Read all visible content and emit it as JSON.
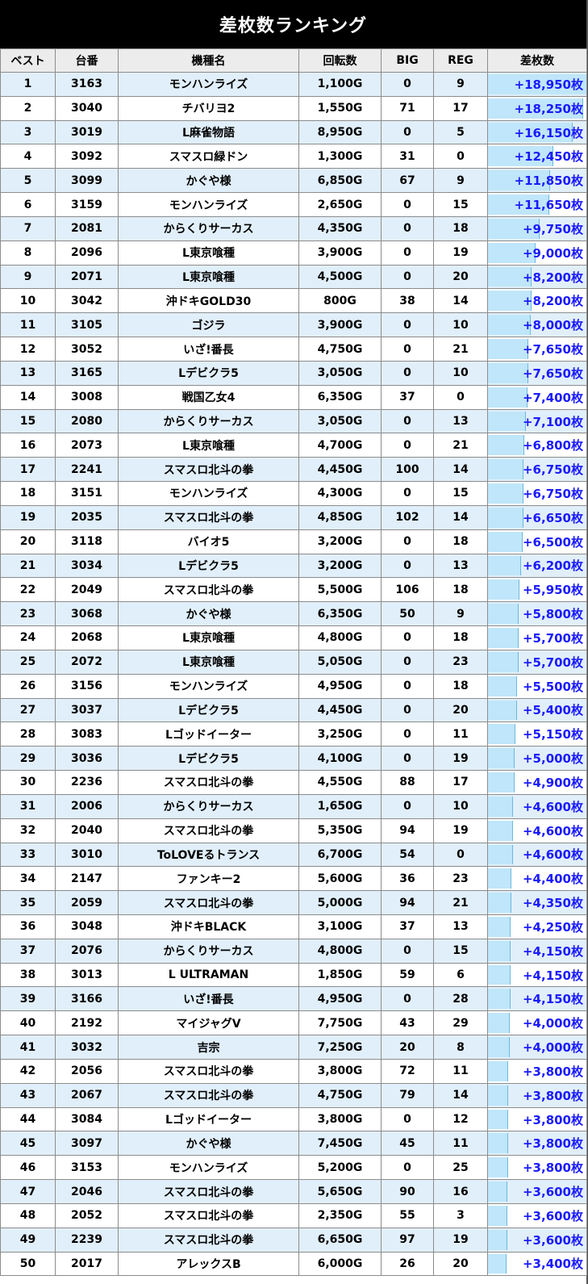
{
  "title": "差枚数ランキング",
  "headers": [
    "ベスト",
    "台番",
    "機種名",
    "回転数",
    "BIG",
    "REG",
    "差枚数"
  ],
  "colors": {
    "header_bg": "#000000",
    "odd_row": "#e1effa",
    "bar": "#bfe6fa",
    "diff_text": "#1a1aff"
  },
  "bar_max": 18950,
  "rows": [
    {
      "rank": "1",
      "machine_no": "3163",
      "name": "モンハンライズ",
      "spins": "1,100G",
      "big": "0",
      "reg": "9",
      "diff": "+18,950枚",
      "diff_value": 18950
    },
    {
      "rank": "2",
      "machine_no": "3040",
      "name": "チバリヨ2",
      "spins": "1,550G",
      "big": "71",
      "reg": "17",
      "diff": "+18,250枚",
      "diff_value": 18250
    },
    {
      "rank": "3",
      "machine_no": "3019",
      "name": "L麻雀物語",
      "spins": "8,950G",
      "big": "0",
      "reg": "5",
      "diff": "+16,150枚",
      "diff_value": 16150
    },
    {
      "rank": "4",
      "machine_no": "3092",
      "name": "スマスロ緑ドン",
      "spins": "1,300G",
      "big": "31",
      "reg": "0",
      "diff": "+12,450枚",
      "diff_value": 12450
    },
    {
      "rank": "5",
      "machine_no": "3099",
      "name": "かぐや様",
      "spins": "6,850G",
      "big": "67",
      "reg": "9",
      "diff": "+11,850枚",
      "diff_value": 11850
    },
    {
      "rank": "6",
      "machine_no": "3159",
      "name": "モンハンライズ",
      "spins": "2,650G",
      "big": "0",
      "reg": "15",
      "diff": "+11,650枚",
      "diff_value": 11650
    },
    {
      "rank": "7",
      "machine_no": "2081",
      "name": "からくりサーカス",
      "spins": "4,350G",
      "big": "0",
      "reg": "18",
      "diff": "+9,750枚",
      "diff_value": 9750
    },
    {
      "rank": "8",
      "machine_no": "2096",
      "name": "L東京喰種",
      "spins": "3,900G",
      "big": "0",
      "reg": "19",
      "diff": "+9,000枚",
      "diff_value": 9000
    },
    {
      "rank": "9",
      "machine_no": "2071",
      "name": "L東京喰種",
      "spins": "4,500G",
      "big": "0",
      "reg": "20",
      "diff": "+8,200枚",
      "diff_value": 8200
    },
    {
      "rank": "10",
      "machine_no": "3042",
      "name": "沖ドキGOLD30",
      "spins": "800G",
      "big": "38",
      "reg": "14",
      "diff": "+8,200枚",
      "diff_value": 8200
    },
    {
      "rank": "11",
      "machine_no": "3105",
      "name": "ゴジラ",
      "spins": "3,900G",
      "big": "0",
      "reg": "10",
      "diff": "+8,000枚",
      "diff_value": 8000
    },
    {
      "rank": "12",
      "machine_no": "3052",
      "name": "いざ!番長",
      "spins": "4,750G",
      "big": "0",
      "reg": "21",
      "diff": "+7,650枚",
      "diff_value": 7650
    },
    {
      "rank": "13",
      "machine_no": "3165",
      "name": "Lデビクラ5",
      "spins": "3,050G",
      "big": "0",
      "reg": "10",
      "diff": "+7,650枚",
      "diff_value": 7650
    },
    {
      "rank": "14",
      "machine_no": "3008",
      "name": "戦国乙女4",
      "spins": "6,350G",
      "big": "37",
      "reg": "0",
      "diff": "+7,400枚",
      "diff_value": 7400
    },
    {
      "rank": "15",
      "machine_no": "2080",
      "name": "からくりサーカス",
      "spins": "3,050G",
      "big": "0",
      "reg": "13",
      "diff": "+7,100枚",
      "diff_value": 7100
    },
    {
      "rank": "16",
      "machine_no": "2073",
      "name": "L東京喰種",
      "spins": "4,700G",
      "big": "0",
      "reg": "21",
      "diff": "+6,800枚",
      "diff_value": 6800
    },
    {
      "rank": "17",
      "machine_no": "2241",
      "name": "スマスロ北斗の拳",
      "spins": "4,450G",
      "big": "100",
      "reg": "14",
      "diff": "+6,750枚",
      "diff_value": 6750
    },
    {
      "rank": "18",
      "machine_no": "3151",
      "name": "モンハンライズ",
      "spins": "4,300G",
      "big": "0",
      "reg": "15",
      "diff": "+6,750枚",
      "diff_value": 6750
    },
    {
      "rank": "19",
      "machine_no": "2035",
      "name": "スマスロ北斗の拳",
      "spins": "4,850G",
      "big": "102",
      "reg": "14",
      "diff": "+6,650枚",
      "diff_value": 6650
    },
    {
      "rank": "20",
      "machine_no": "3118",
      "name": "バイオ5",
      "spins": "3,200G",
      "big": "0",
      "reg": "18",
      "diff": "+6,500枚",
      "diff_value": 6500
    },
    {
      "rank": "21",
      "machine_no": "3034",
      "name": "Lデビクラ5",
      "spins": "3,200G",
      "big": "0",
      "reg": "13",
      "diff": "+6,200枚",
      "diff_value": 6200
    },
    {
      "rank": "22",
      "machine_no": "2049",
      "name": "スマスロ北斗の拳",
      "spins": "5,500G",
      "big": "106",
      "reg": "18",
      "diff": "+5,950枚",
      "diff_value": 5950
    },
    {
      "rank": "23",
      "machine_no": "3068",
      "name": "かぐや様",
      "spins": "6,350G",
      "big": "50",
      "reg": "9",
      "diff": "+5,800枚",
      "diff_value": 5800
    },
    {
      "rank": "24",
      "machine_no": "2068",
      "name": "L東京喰種",
      "spins": "4,800G",
      "big": "0",
      "reg": "18",
      "diff": "+5,700枚",
      "diff_value": 5700
    },
    {
      "rank": "25",
      "machine_no": "2072",
      "name": "L東京喰種",
      "spins": "5,050G",
      "big": "0",
      "reg": "23",
      "diff": "+5,700枚",
      "diff_value": 5700
    },
    {
      "rank": "26",
      "machine_no": "3156",
      "name": "モンハンライズ",
      "spins": "4,950G",
      "big": "0",
      "reg": "18",
      "diff": "+5,500枚",
      "diff_value": 5500
    },
    {
      "rank": "27",
      "machine_no": "3037",
      "name": "Lデビクラ5",
      "spins": "4,450G",
      "big": "0",
      "reg": "20",
      "diff": "+5,400枚",
      "diff_value": 5400
    },
    {
      "rank": "28",
      "machine_no": "3083",
      "name": "Lゴッドイーター",
      "spins": "3,250G",
      "big": "0",
      "reg": "11",
      "diff": "+5,150枚",
      "diff_value": 5150
    },
    {
      "rank": "29",
      "machine_no": "3036",
      "name": "Lデビクラ5",
      "spins": "4,100G",
      "big": "0",
      "reg": "19",
      "diff": "+5,000枚",
      "diff_value": 5000
    },
    {
      "rank": "30",
      "machine_no": "2236",
      "name": "スマスロ北斗の拳",
      "spins": "4,550G",
      "big": "88",
      "reg": "17",
      "diff": "+4,900枚",
      "diff_value": 4900
    },
    {
      "rank": "31",
      "machine_no": "2006",
      "name": "からくりサーカス",
      "spins": "1,650G",
      "big": "0",
      "reg": "10",
      "diff": "+4,600枚",
      "diff_value": 4600
    },
    {
      "rank": "32",
      "machine_no": "2040",
      "name": "スマスロ北斗の拳",
      "spins": "5,350G",
      "big": "94",
      "reg": "19",
      "diff": "+4,600枚",
      "diff_value": 4600
    },
    {
      "rank": "33",
      "machine_no": "3010",
      "name": "ToLOVEるトランス",
      "spins": "6,700G",
      "big": "54",
      "reg": "0",
      "diff": "+4,600枚",
      "diff_value": 4600
    },
    {
      "rank": "34",
      "machine_no": "2147",
      "name": "ファンキー2",
      "spins": "5,600G",
      "big": "36",
      "reg": "23",
      "diff": "+4,400枚",
      "diff_value": 4400
    },
    {
      "rank": "35",
      "machine_no": "2059",
      "name": "スマスロ北斗の拳",
      "spins": "5,000G",
      "big": "94",
      "reg": "21",
      "diff": "+4,350枚",
      "diff_value": 4350
    },
    {
      "rank": "36",
      "machine_no": "3048",
      "name": "沖ドキBLACK",
      "spins": "3,100G",
      "big": "37",
      "reg": "13",
      "diff": "+4,250枚",
      "diff_value": 4250
    },
    {
      "rank": "37",
      "machine_no": "2076",
      "name": "からくりサーカス",
      "spins": "4,800G",
      "big": "0",
      "reg": "15",
      "diff": "+4,150枚",
      "diff_value": 4150
    },
    {
      "rank": "38",
      "machine_no": "3013",
      "name": "L ULTRAMAN",
      "spins": "1,850G",
      "big": "59",
      "reg": "6",
      "diff": "+4,150枚",
      "diff_value": 4150
    },
    {
      "rank": "39",
      "machine_no": "3166",
      "name": "いざ!番長",
      "spins": "4,950G",
      "big": "0",
      "reg": "28",
      "diff": "+4,150枚",
      "diff_value": 4150
    },
    {
      "rank": "40",
      "machine_no": "2192",
      "name": "マイジャグV",
      "spins": "7,750G",
      "big": "43",
      "reg": "29",
      "diff": "+4,000枚",
      "diff_value": 4000
    },
    {
      "rank": "41",
      "machine_no": "3032",
      "name": "吉宗",
      "spins": "7,250G",
      "big": "20",
      "reg": "8",
      "diff": "+4,000枚",
      "diff_value": 4000
    },
    {
      "rank": "42",
      "machine_no": "2056",
      "name": "スマスロ北斗の拳",
      "spins": "3,800G",
      "big": "72",
      "reg": "11",
      "diff": "+3,800枚",
      "diff_value": 3800
    },
    {
      "rank": "43",
      "machine_no": "2067",
      "name": "スマスロ北斗の拳",
      "spins": "4,750G",
      "big": "79",
      "reg": "14",
      "diff": "+3,800枚",
      "diff_value": 3800
    },
    {
      "rank": "44",
      "machine_no": "3084",
      "name": "Lゴッドイーター",
      "spins": "3,800G",
      "big": "0",
      "reg": "12",
      "diff": "+3,800枚",
      "diff_value": 3800
    },
    {
      "rank": "45",
      "machine_no": "3097",
      "name": "かぐや様",
      "spins": "7,450G",
      "big": "45",
      "reg": "11",
      "diff": "+3,800枚",
      "diff_value": 3800
    },
    {
      "rank": "46",
      "machine_no": "3153",
      "name": "モンハンライズ",
      "spins": "5,200G",
      "big": "0",
      "reg": "25",
      "diff": "+3,800枚",
      "diff_value": 3800
    },
    {
      "rank": "47",
      "machine_no": "2046",
      "name": "スマスロ北斗の拳",
      "spins": "5,650G",
      "big": "90",
      "reg": "16",
      "diff": "+3,600枚",
      "diff_value": 3600
    },
    {
      "rank": "48",
      "machine_no": "2052",
      "name": "スマスロ北斗の拳",
      "spins": "2,350G",
      "big": "55",
      "reg": "3",
      "diff": "+3,600枚",
      "diff_value": 3600
    },
    {
      "rank": "49",
      "machine_no": "2239",
      "name": "スマスロ北斗の拳",
      "spins": "6,650G",
      "big": "97",
      "reg": "19",
      "diff": "+3,600枚",
      "diff_value": 3600
    },
    {
      "rank": "50",
      "machine_no": "2017",
      "name": "アレックスB",
      "spins": "6,000G",
      "big": "26",
      "reg": "20",
      "diff": "+3,400枚",
      "diff_value": 3400
    }
  ]
}
